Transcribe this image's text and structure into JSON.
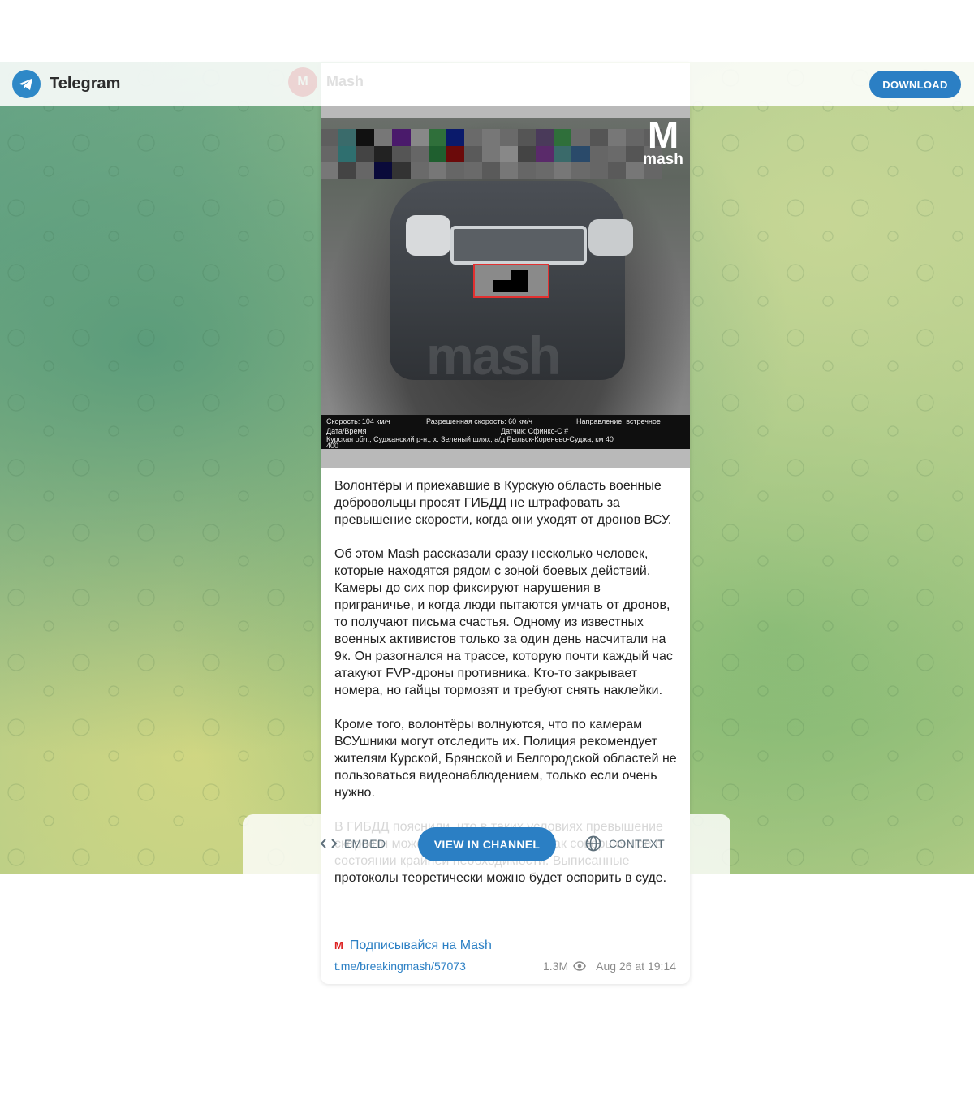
{
  "header": {
    "app_title": "Telegram",
    "download_label": "DOWNLOAD"
  },
  "channel": {
    "name": "Mash",
    "logo_text": "mash"
  },
  "photo": {
    "overlay": {
      "speed": "Скорость: 104 км/ч",
      "allowed_speed": "Разрешенная скорость: 60 км/ч",
      "direction": "Направление: встречное",
      "datetime": "Дата/Время",
      "sensor": "Датчик: Сфинкс-С #",
      "location": "Курская обл., Суджанский р-н., х. Зеленый шлях, а/д Рыльск-Коренево-Суджа, км 40",
      "extra": "400"
    },
    "watermark": "mash",
    "plate_border_color": "#e23030"
  },
  "post": {
    "paragraphs": [
      "Волонтёры и приехавшие в Курскую область военные добровольцы просят ГИБДД не штрафовать за превышение скорости, когда они уходят от дронов ВСУ.",
      "Об этом Mash рассказали сразу несколько человек, которые находятся рядом с зоной боевых действий. Камеры до сих пор фиксируют нарушения в приграничье, и когда люди пытаются умчать от дронов, то получают письма счастья. Одному из известных военных активистов только за один день насчитали на 9к. Он разогнался на трассе, которую почти каждый час атакуют FVP-дроны противника. Кто-то закрывает номера, но гайцы тормозят и требуют снять наклейки.",
      "Кроме того, волонтёры волнуются, что по камерам ВСУшники могут отследить их. Полиция рекомендует жителям Курской, Брянской и Белгородской областей не пользоваться видеонаблюдением, только если очень нужно.",
      "В ГИБДД пояснили, что в таких условиях превышение скорости может быть рассмотрено как совершенное в состоянии крайней необходимости. Выписанные протоколы теоретически можно будет оспорить в суде."
    ],
    "subscribe_text": "Подписывайся на Mash",
    "link": "t.me/breakingmash/57073",
    "views": "1.3M",
    "date": "Aug 26 at 19:14"
  },
  "actions": {
    "embed_label": "EMBED",
    "view_label": "VIEW IN CHANNEL",
    "context_label": "CONTEXT"
  },
  "colors": {
    "accent": "#2b7fc4",
    "telegram_blue": "#2e88c7"
  }
}
